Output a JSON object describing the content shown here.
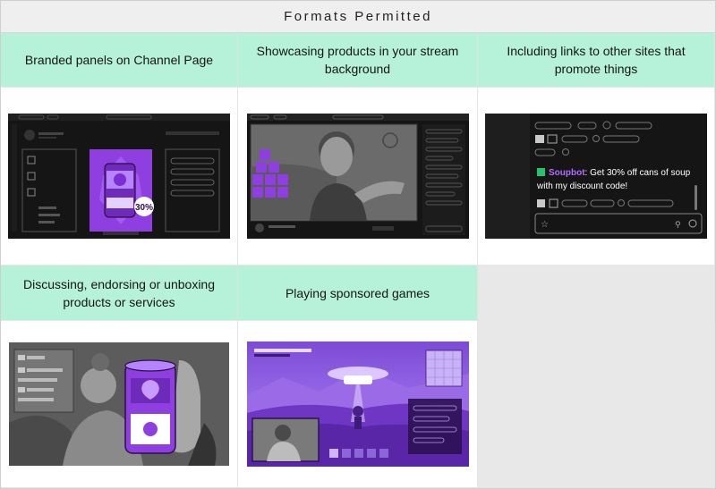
{
  "page": {
    "title": "Formats Permitted"
  },
  "columns": [
    {
      "heading": "Branded panels on Channel Page",
      "image_label": "30%"
    },
    {
      "heading": "Showcasing products in your stream background"
    },
    {
      "heading": "Including links to other sites that promote things",
      "chat": {
        "username": "Soupbot",
        "message_line1": ": Get 30% off cans of soup",
        "message_line2": "with my discount code!"
      }
    }
  ],
  "row2": [
    {
      "heading": "Discussing, endorsing or unboxing products or services"
    },
    {
      "heading": "Playing sponsored games"
    },
    {
      "heading": ""
    }
  ],
  "colors": {
    "header_bg": "#b6f2d9",
    "empty_bg": "#e8e8e8",
    "accent_purple": "#8f3fe0",
    "dark_ui": "#151515"
  }
}
